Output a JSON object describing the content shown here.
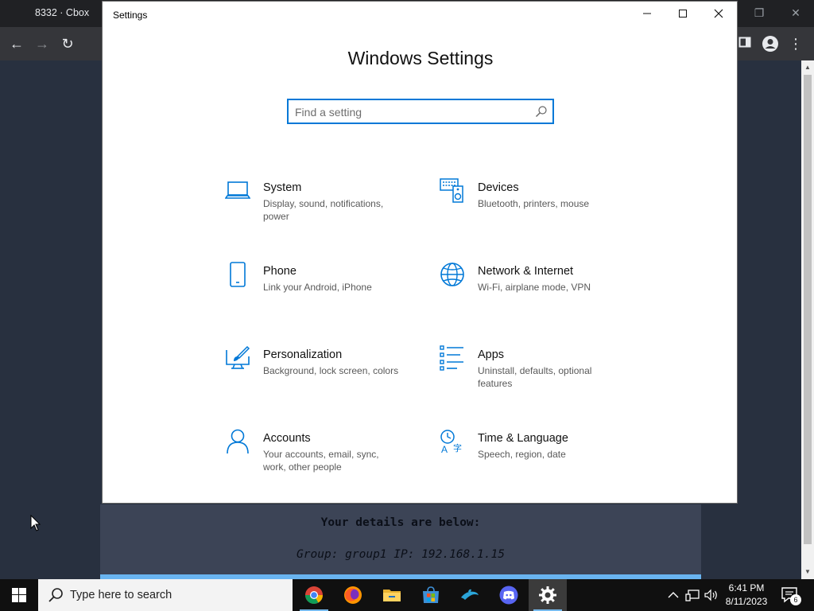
{
  "browser": {
    "tab_title": "8332 · Cbox",
    "page": {
      "details_heading": "Your details are below:",
      "details_line": "Group: group1   IP: 192.168.1.15"
    }
  },
  "settings": {
    "window_title": "Settings",
    "heading": "Windows Settings",
    "search_placeholder": "Find a setting",
    "categories": [
      {
        "name": "System",
        "desc": "Display, sound, notifications, power",
        "icon": "laptop-icon"
      },
      {
        "name": "Devices",
        "desc": "Bluetooth, printers, mouse",
        "icon": "devices-icon"
      },
      {
        "name": "Phone",
        "desc": "Link your Android, iPhone",
        "icon": "phone-icon"
      },
      {
        "name": "Network & Internet",
        "desc": "Wi-Fi, airplane mode, VPN",
        "icon": "globe-icon"
      },
      {
        "name": "Personalization",
        "desc": "Background, lock screen, colors",
        "icon": "paintbrush-icon"
      },
      {
        "name": "Apps",
        "desc": "Uninstall, defaults, optional features",
        "icon": "apps-list-icon"
      },
      {
        "name": "Accounts",
        "desc": "Your accounts, email, sync, work, other people",
        "icon": "person-icon"
      },
      {
        "name": "Time & Language",
        "desc": "Speech, region, date",
        "icon": "time-language-icon"
      }
    ],
    "accent_color": "#0078d7"
  },
  "taskbar": {
    "search_placeholder": "Type here to search",
    "apps": [
      "chrome-icon",
      "firefox-icon",
      "file-explorer-icon",
      "microsoft-store-icon",
      "dolphin-icon",
      "discord-icon",
      "settings-gear-icon"
    ],
    "time": "6:41 PM",
    "date": "8/11/2023",
    "notification_count": "6"
  }
}
